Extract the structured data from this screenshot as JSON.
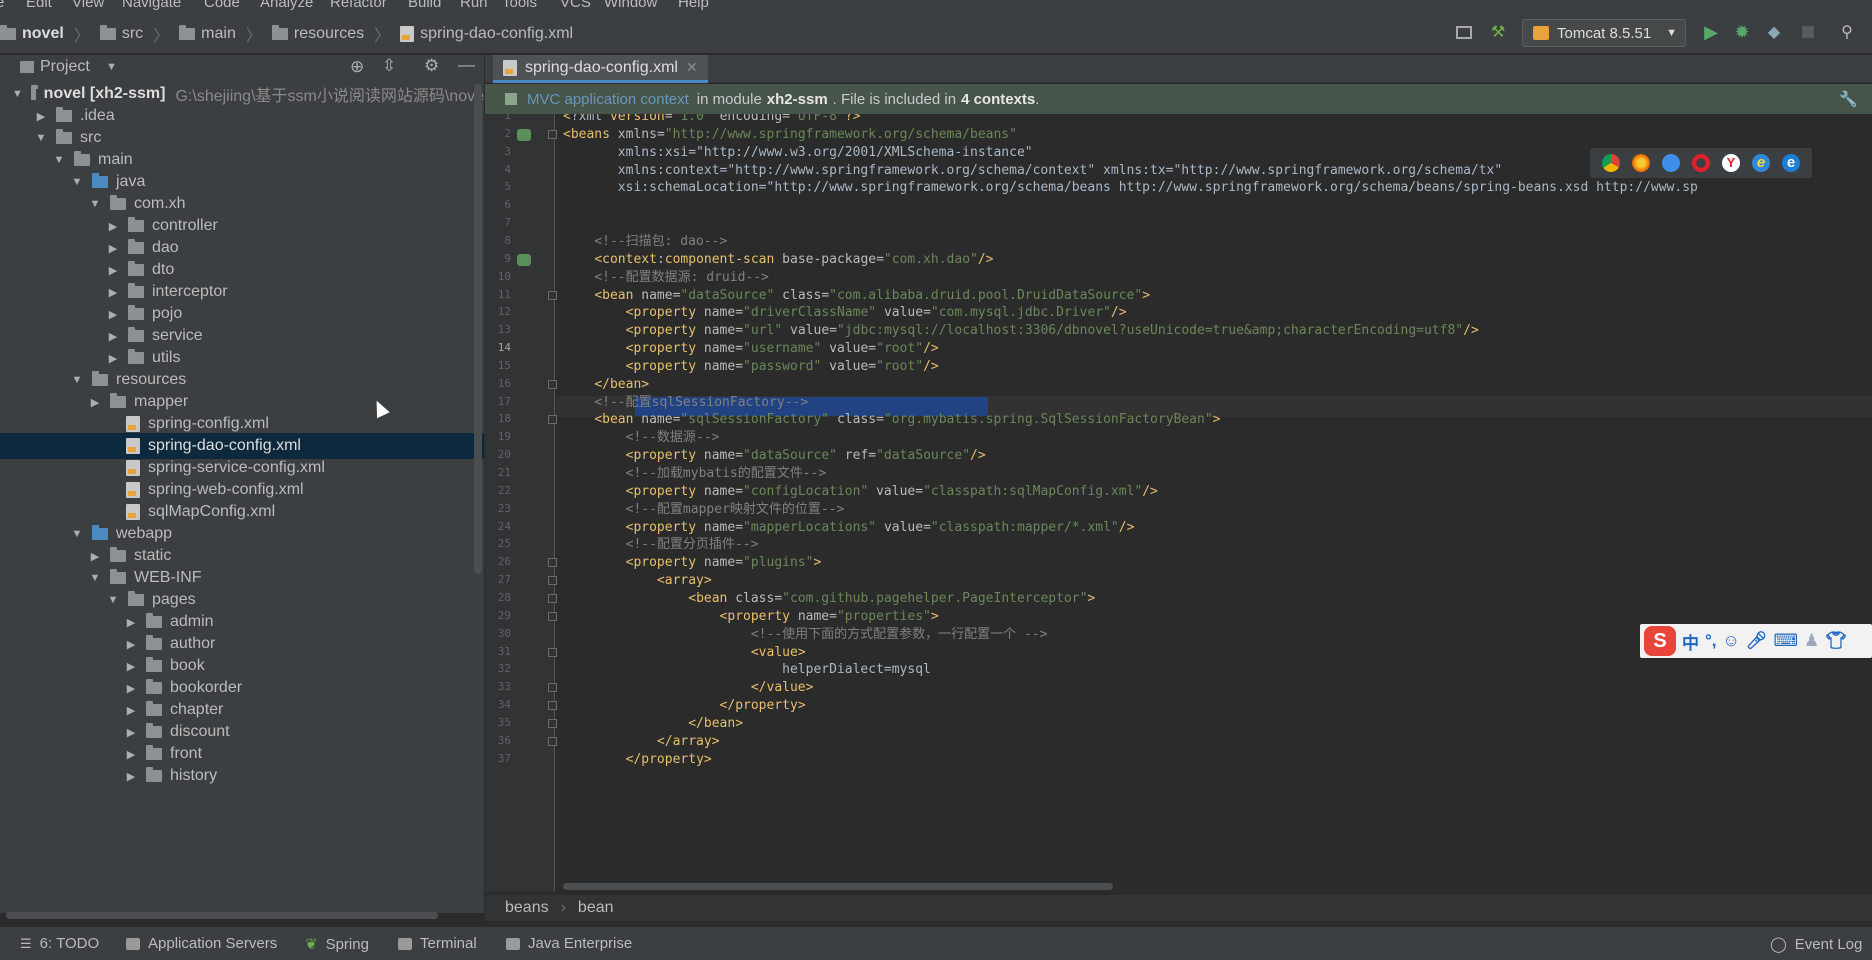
{
  "menu": [
    "e",
    "Edit",
    "View",
    "Navigate",
    "Code",
    "Analyze",
    "Refactor",
    "Build",
    "Run",
    "Tools",
    "VCS",
    "Window",
    "Help"
  ],
  "breadcrumbs": [
    "novel",
    "src",
    "main",
    "resources",
    "spring-dao-config.xml"
  ],
  "run_config": "Tomcat 8.5.51",
  "project_panel": {
    "title": "Project",
    "tree": [
      {
        "label": "novel [xh2-ssm]",
        "hint": "G:\\shejiing\\基于ssm小说阅读网站源码\\nove"
      },
      {
        "label": ".idea"
      },
      {
        "label": "src"
      },
      {
        "label": "main"
      },
      {
        "label": "java"
      },
      {
        "label": "com.xh"
      },
      {
        "label": "controller"
      },
      {
        "label": "dao"
      },
      {
        "label": "dto"
      },
      {
        "label": "interceptor"
      },
      {
        "label": "pojo"
      },
      {
        "label": "service"
      },
      {
        "label": "utils"
      },
      {
        "label": "resources"
      },
      {
        "label": "mapper"
      },
      {
        "label": "spring-config.xml"
      },
      {
        "label": "spring-dao-config.xml"
      },
      {
        "label": "spring-service-config.xml"
      },
      {
        "label": "spring-web-config.xml"
      },
      {
        "label": "sqlMapConfig.xml"
      },
      {
        "label": "webapp"
      },
      {
        "label": "static"
      },
      {
        "label": "WEB-INF"
      },
      {
        "label": "pages"
      },
      {
        "label": "admin"
      },
      {
        "label": "author"
      },
      {
        "label": "book"
      },
      {
        "label": "bookorder"
      },
      {
        "label": "chapter"
      },
      {
        "label": "discount"
      },
      {
        "label": "front"
      },
      {
        "label": "history"
      }
    ]
  },
  "editor": {
    "tab": "spring-dao-config.xml",
    "banner": {
      "link": "MVC application context",
      "text1": "in module",
      "module": "xh2-ssm",
      "text2": ". File is included in",
      "contexts": "4 contexts",
      "text3": "."
    },
    "line_numbers": [
      "1",
      "2",
      "3",
      "4",
      "5",
      "6",
      "7",
      "8",
      "9",
      "10",
      "11",
      "12",
      "13",
      "14",
      "15",
      "16",
      "17",
      "18",
      "19",
      "20",
      "21",
      "22",
      "23",
      "24",
      "25",
      "26",
      "27",
      "28",
      "29",
      "30",
      "31",
      "32",
      "33",
      "34",
      "35",
      "36",
      "37"
    ],
    "code": [
      "<?xml version=\"1.0\" encoding=\"UTF-8\"?>",
      "<beans xmlns=\"http://www.springframework.org/schema/beans\"",
      "       xmlns:xsi=\"http://www.w3.org/2001/XMLSchema-instance\"",
      "       xmlns:context=\"http://www.springframework.org/schema/context\" xmlns:tx=\"http://www.springframework.org/schema/tx\"",
      "       xsi:schemaLocation=\"http://www.springframework.org/schema/beans http://www.springframework.org/schema/beans/spring-beans.xsd http://www.sp",
      "",
      "",
      "    <!--扫描包: dao-->",
      "    <context:component-scan base-package=\"com.xh.dao\"/>",
      "    <!--配置数据源: druid-->",
      "    <bean name=\"dataSource\" class=\"com.alibaba.druid.pool.DruidDataSource\">",
      "        <property name=\"driverClassName\" value=\"com.mysql.jdbc.Driver\"/>",
      "        <property name=\"url\" value=\"jdbc:mysql://localhost:3306/dbnovel?useUnicode=true&amp;characterEncoding=utf8\"/>",
      "        <property name=\"username\" value=\"root\"/>",
      "        <property name=\"password\" value=\"root\"/>",
      "    </bean>",
      "    <!--配置sqlSessionFactory-->",
      "    <bean name=\"sqlSessionFactory\" class=\"org.mybatis.spring.SqlSessionFactoryBean\">",
      "        <!--数据源-->",
      "        <property name=\"dataSource\" ref=\"dataSource\"/>",
      "        <!--加载mybatis的配置文件-->",
      "        <property name=\"configLocation\" value=\"classpath:sqlMapConfig.xml\"/>",
      "        <!--配置mapper映射文件的位置-->",
      "        <property name=\"mapperLocations\" value=\"classpath:mapper/*.xml\"/>",
      "        <!--配置分页插件-->",
      "        <property name=\"plugins\">",
      "            <array>",
      "                <bean class=\"com.github.pagehelper.PageInterceptor\">",
      "                    <property name=\"properties\">",
      "                        <!--使用下面的方式配置参数，一行配置一个 -->",
      "                        <value>",
      "                            helperDialect=mysql",
      "                        </value>",
      "                    </property>",
      "                </bean>",
      "            </array>",
      "        </property>"
    ],
    "current_line": 14,
    "breadcrumb": [
      "beans",
      "bean"
    ]
  },
  "ime": {
    "lang": "中",
    "punct": "°,"
  },
  "bottom_tools": [
    "6: TODO",
    "Application Servers",
    "Spring",
    "Terminal",
    "Java Enterprise"
  ],
  "event_log": "Event Log"
}
